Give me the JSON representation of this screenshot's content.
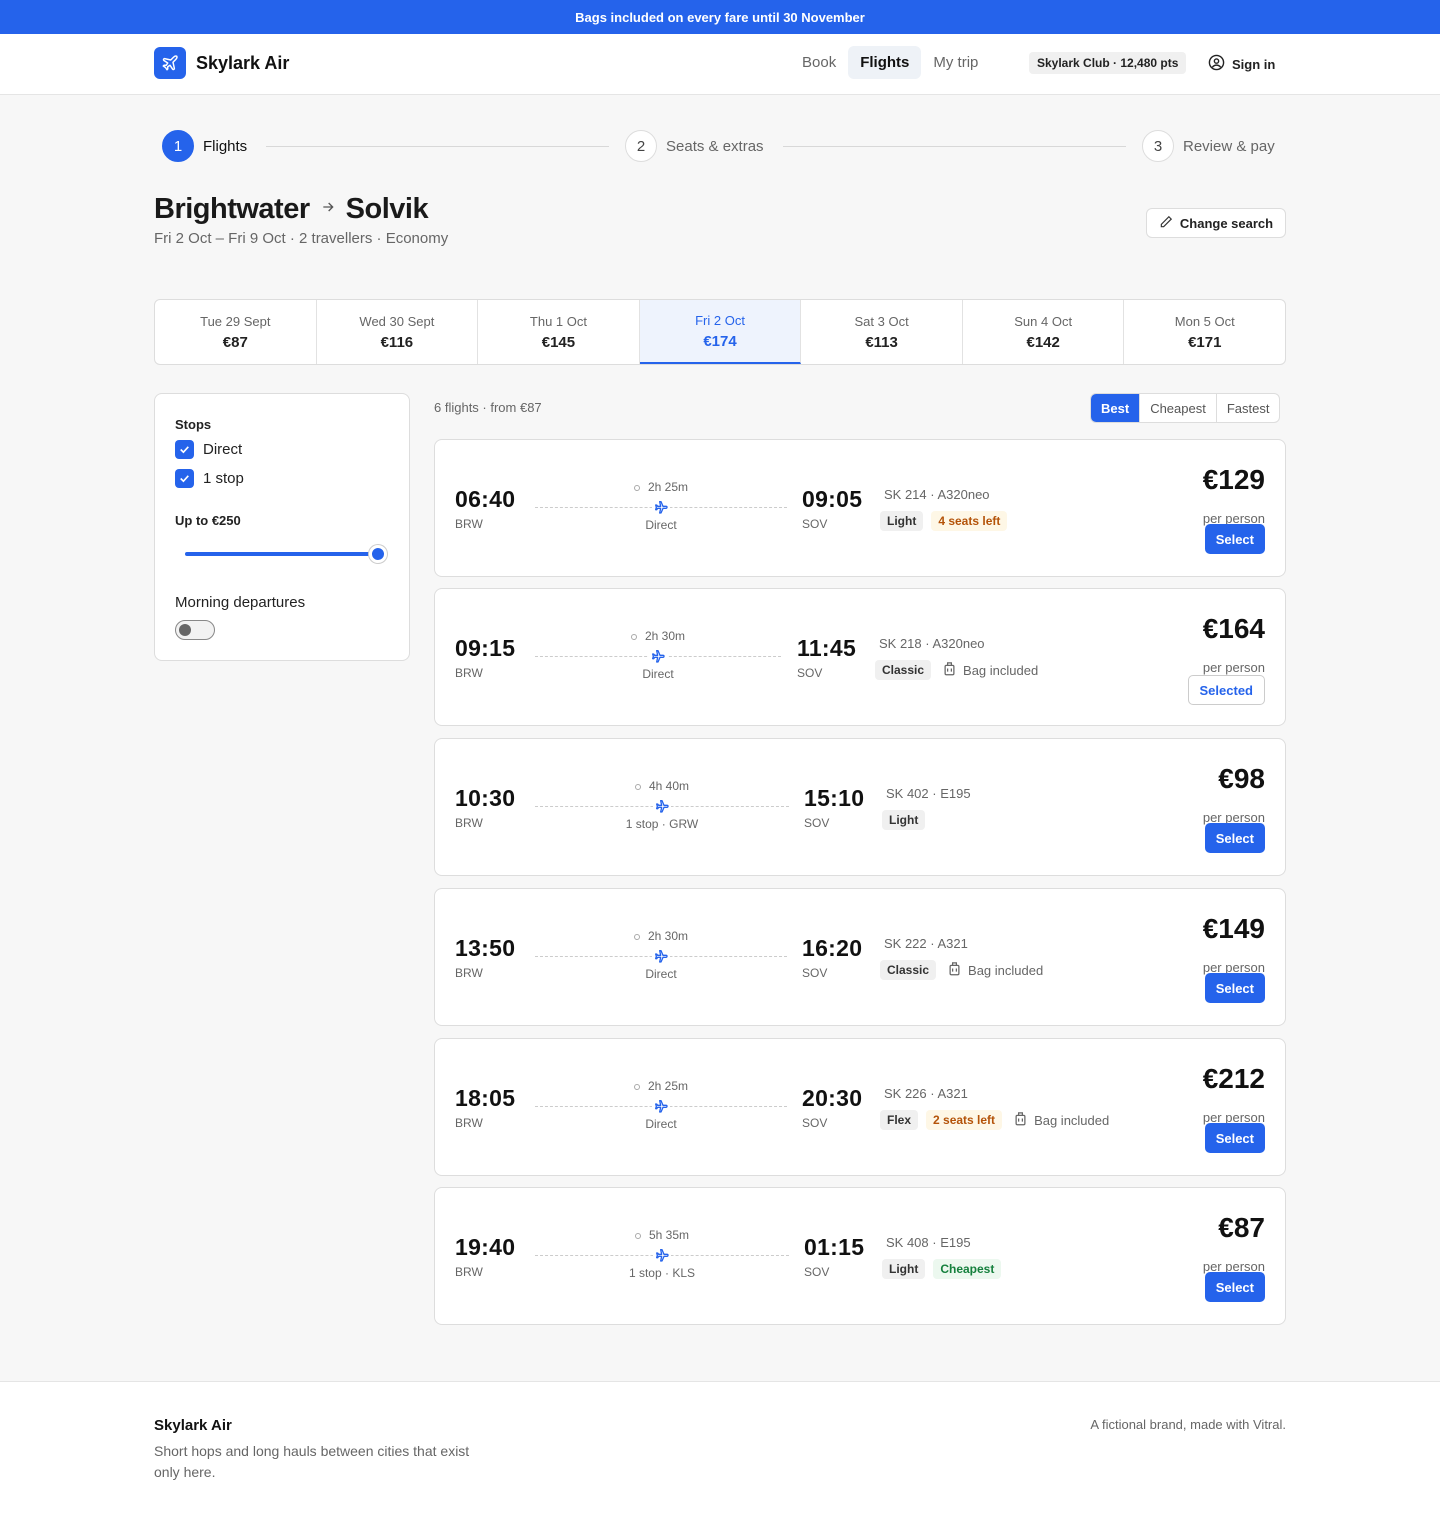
{
  "banner": "Bags included on every fare until 30 November",
  "brand": {
    "name": "Skylark Air",
    "accent": "#2563eb"
  },
  "nav": {
    "items": [
      "Book",
      "Flights",
      "My trip"
    ],
    "active": "Flights"
  },
  "club": "Skylark Club · 12,480 pts",
  "signin": "Sign in",
  "steps": [
    {
      "num": "1",
      "label": "Flights"
    },
    {
      "num": "2",
      "label": "Seats & extras"
    },
    {
      "num": "3",
      "label": "Review & pay"
    }
  ],
  "route": {
    "from": "Brightwater",
    "to": "Solvik",
    "summary": "Fri 2 Oct – Fri 9 Oct · 2 travellers · Economy"
  },
  "change_search": "Change search",
  "dates": [
    {
      "day": "Tue 29 Sept",
      "price": "€87"
    },
    {
      "day": "Wed 30 Sept",
      "price": "€116"
    },
    {
      "day": "Thu 1 Oct",
      "price": "€145"
    },
    {
      "day": "Fri 2 Oct",
      "price": "€174"
    },
    {
      "day": "Sat 3 Oct",
      "price": "€113"
    },
    {
      "day": "Sun 4 Oct",
      "price": "€142"
    },
    {
      "day": "Mon 5 Oct",
      "price": "€171"
    }
  ],
  "filters": {
    "stops_title": "Stops",
    "direct": "Direct",
    "one_stop": "1 stop",
    "price_title": "Up to €250",
    "price_fraction": 1.0,
    "morning": "Morning departures"
  },
  "results": {
    "meta": "6 flights · from €87"
  },
  "sort": [
    "Best",
    "Cheapest",
    "Fastest"
  ],
  "per_person": "per person",
  "bag_label": "Bag included",
  "flights": [
    {
      "dep": "06:40",
      "from": "BRW",
      "dur": "2h 25m",
      "stops": "Direct",
      "arr": "09:05",
      "to": "SOV",
      "flight": "SK 214 · A320neo",
      "fare": "Light",
      "seats": "4 seats left",
      "price": "€129",
      "button": "Select"
    },
    {
      "dep": "09:15",
      "from": "BRW",
      "dur": "2h 30m",
      "stops": "Direct",
      "arr": "11:45",
      "to": "SOV",
      "flight": "SK 218 · A320neo",
      "fare": "Classic",
      "price": "€164",
      "button": "Selected"
    },
    {
      "dep": "10:30",
      "from": "BRW",
      "dur": "4h 40m",
      "stops": "1 stop · GRW",
      "arr": "15:10",
      "to": "SOV",
      "flight": "SK 402 · E195",
      "fare": "Light",
      "price": "€98",
      "button": "Select"
    },
    {
      "dep": "13:50",
      "from": "BRW",
      "dur": "2h 30m",
      "stops": "Direct",
      "arr": "16:20",
      "to": "SOV",
      "flight": "SK 222 · A321",
      "fare": "Classic",
      "price": "€149",
      "button": "Select"
    },
    {
      "dep": "18:05",
      "from": "BRW",
      "dur": "2h 25m",
      "stops": "Direct",
      "arr": "20:30",
      "to": "SOV",
      "flight": "SK 226 · A321",
      "fare": "Flex",
      "seats": "2 seats left",
      "price": "€212",
      "button": "Select"
    },
    {
      "dep": "19:40",
      "from": "BRW",
      "dur": "5h 35m",
      "stops": "1 stop · KLS",
      "arr": "01:15",
      "to": "SOV",
      "flight": "SK 408 · E195",
      "fare": "Light",
      "badge": "Cheapest",
      "price": "€87",
      "button": "Select"
    }
  ],
  "footer": {
    "brand": "Skylark Air",
    "desc": "Short hops and long hauls between cities that exist only here.",
    "note": "A fictional brand, made with Vitral."
  },
  "icons": {
    "logo": "plane-icon",
    "signin": "user-circle-icon",
    "edit": "pencil-icon",
    "bag": "luggage-icon"
  }
}
